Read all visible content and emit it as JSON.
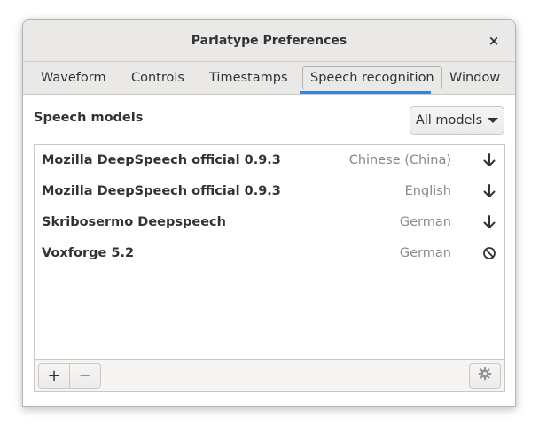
{
  "window": {
    "title": "Parlatype Preferences",
    "close_label": "×"
  },
  "tabs": [
    {
      "label": "Waveform",
      "active": false
    },
    {
      "label": "Controls",
      "active": false
    },
    {
      "label": "Timestamps",
      "active": false
    },
    {
      "label": "Speech recognition",
      "active": true
    },
    {
      "label": "Window",
      "active": false
    }
  ],
  "speech": {
    "section_label": "Speech models",
    "filter_label": "All models",
    "models": [
      {
        "name": "Mozilla DeepSpeech official 0.9.3",
        "language": "Chinese (China)",
        "action_icon": "download-icon"
      },
      {
        "name": "Mozilla DeepSpeech official 0.9.3",
        "language": "English",
        "action_icon": "download-icon"
      },
      {
        "name": "Skribosermo Deepspeech",
        "language": "German",
        "action_icon": "download-icon"
      },
      {
        "name": "Voxforge 5.2",
        "language": "German",
        "action_icon": "unavailable-icon"
      }
    ]
  },
  "toolbar": {
    "add_label": "+",
    "remove_label": "−",
    "settings_icon": "gear-icon"
  },
  "colors": {
    "accent": "#3584e4",
    "text": "#2e3436",
    "dim_text": "#888a85"
  }
}
